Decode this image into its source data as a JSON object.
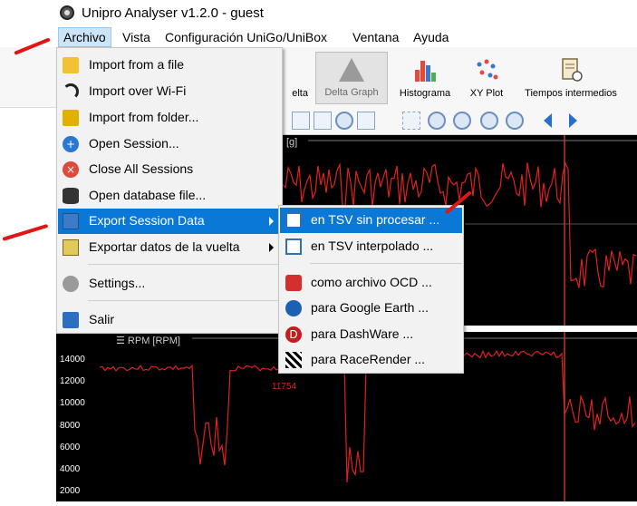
{
  "app": {
    "title": "Unipro Analyser v1.2.0 - guest"
  },
  "menubar": [
    {
      "label": "Archivo",
      "active": true
    },
    {
      "label": "Vista"
    },
    {
      "label": "Configuración UniGo/UniBox"
    },
    {
      "label": "Ventana"
    },
    {
      "label": "Ayuda"
    }
  ],
  "toolbar": {
    "vuelta_partial": "elta",
    "delta_graph": "Delta Graph",
    "histograma": "Histograma",
    "xy_plot": "XY Plot",
    "tiempos": "Tiempos intermedios"
  },
  "archivo_menu": {
    "items": [
      {
        "label": "Import from a file",
        "icon": "import-file-icon"
      },
      {
        "label": "Import over Wi-Fi",
        "icon": "wifi-icon"
      },
      {
        "label": "Import from folder...",
        "icon": "folder-icon"
      },
      {
        "label": "Open Session...",
        "icon": "open-session-icon"
      },
      {
        "label": "Close All Sessions",
        "icon": "close-sessions-icon"
      },
      {
        "label": "Open database file...",
        "icon": "database-icon"
      },
      {
        "label": "Export Session Data",
        "icon": "export-icon",
        "highlighted": true,
        "submenu": true
      },
      {
        "label": "Exportar datos de la vuelta",
        "icon": "export-lap-icon",
        "submenu": true
      },
      {
        "label": "Settings...",
        "icon": "gear-icon"
      },
      {
        "label": "Salir",
        "icon": "exit-icon"
      }
    ]
  },
  "export_submenu": {
    "items": [
      {
        "label": "en TSV sin procesar ...",
        "icon": "tsv-raw-icon",
        "highlighted": true
      },
      {
        "label": "en TSV interpolado ...",
        "icon": "tsv-interp-icon"
      },
      {
        "label": "como archivo OCD ...",
        "icon": "ocd-icon"
      },
      {
        "label": "para Google Earth ...",
        "icon": "google-earth-icon"
      },
      {
        "label": "para DashWare ...",
        "icon": "dashware-icon"
      },
      {
        "label": "para RaceRender ...",
        "icon": "racerender-icon"
      }
    ]
  },
  "graphs": {
    "top_label": "[g]",
    "bottom_label": "☰ RPM [RPM]",
    "rpm_marker": "11754",
    "rpm_ticks": [
      "14000",
      "12000",
      "10000",
      "8000",
      "6000",
      "4000",
      "2000"
    ],
    "trace_color": "#e02020",
    "cursor_color": "#c0392b"
  }
}
